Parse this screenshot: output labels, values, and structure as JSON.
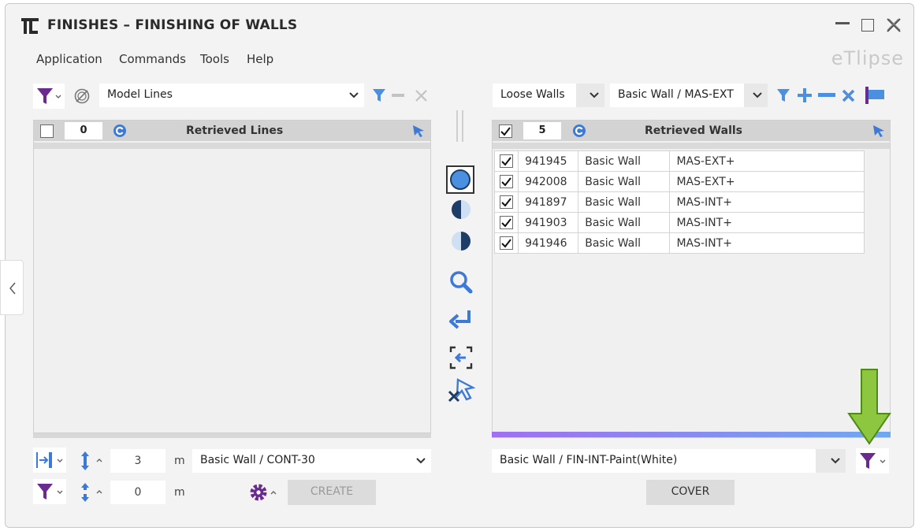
{
  "window": {
    "title": "FINISHES – FINISHING OF WALLS",
    "brand": "eTlipse",
    "minimize": "—",
    "maximize": "☐",
    "close": "✕"
  },
  "menu": [
    "Application",
    "Commands",
    "Tools",
    "Help"
  ],
  "left": {
    "source_select": "Model Lines",
    "count": "0",
    "header_title": "Retrieved Lines",
    "height_value": "3",
    "height_unit": "m",
    "wall_type_select": "Basic Wall / CONT-30",
    "offset_value": "0",
    "offset_unit": "m",
    "create_label": "CREATE"
  },
  "right": {
    "filter_select": "Loose Walls",
    "wall_type_select": "Basic Wall / MAS-EXT",
    "count": "5",
    "header_title": "Retrieved Walls",
    "rows": [
      {
        "checked": true,
        "id": "941945",
        "family": "Basic Wall",
        "type": "MAS-EXT+"
      },
      {
        "checked": true,
        "id": "942008",
        "family": "Basic Wall",
        "type": "MAS-EXT+"
      },
      {
        "checked": true,
        "id": "941897",
        "family": "Basic Wall",
        "type": "MAS-INT+"
      },
      {
        "checked": true,
        "id": "941903",
        "family": "Basic Wall",
        "type": "MAS-INT+"
      },
      {
        "checked": true,
        "id": "941946",
        "family": "Basic Wall",
        "type": "MAS-INT+"
      }
    ],
    "finish_type_select": "Basic Wall / FIN-INT-Paint(White)",
    "cover_label": "COVER"
  },
  "colors": {
    "accent_blue": "#3b82f6",
    "icon_blue": "#4a8fe0",
    "filter_purple": "#6a2b8f",
    "arrow_green": "#8dc63f",
    "progress_start": "#a070f0",
    "progress_end": "#70a8f0"
  }
}
